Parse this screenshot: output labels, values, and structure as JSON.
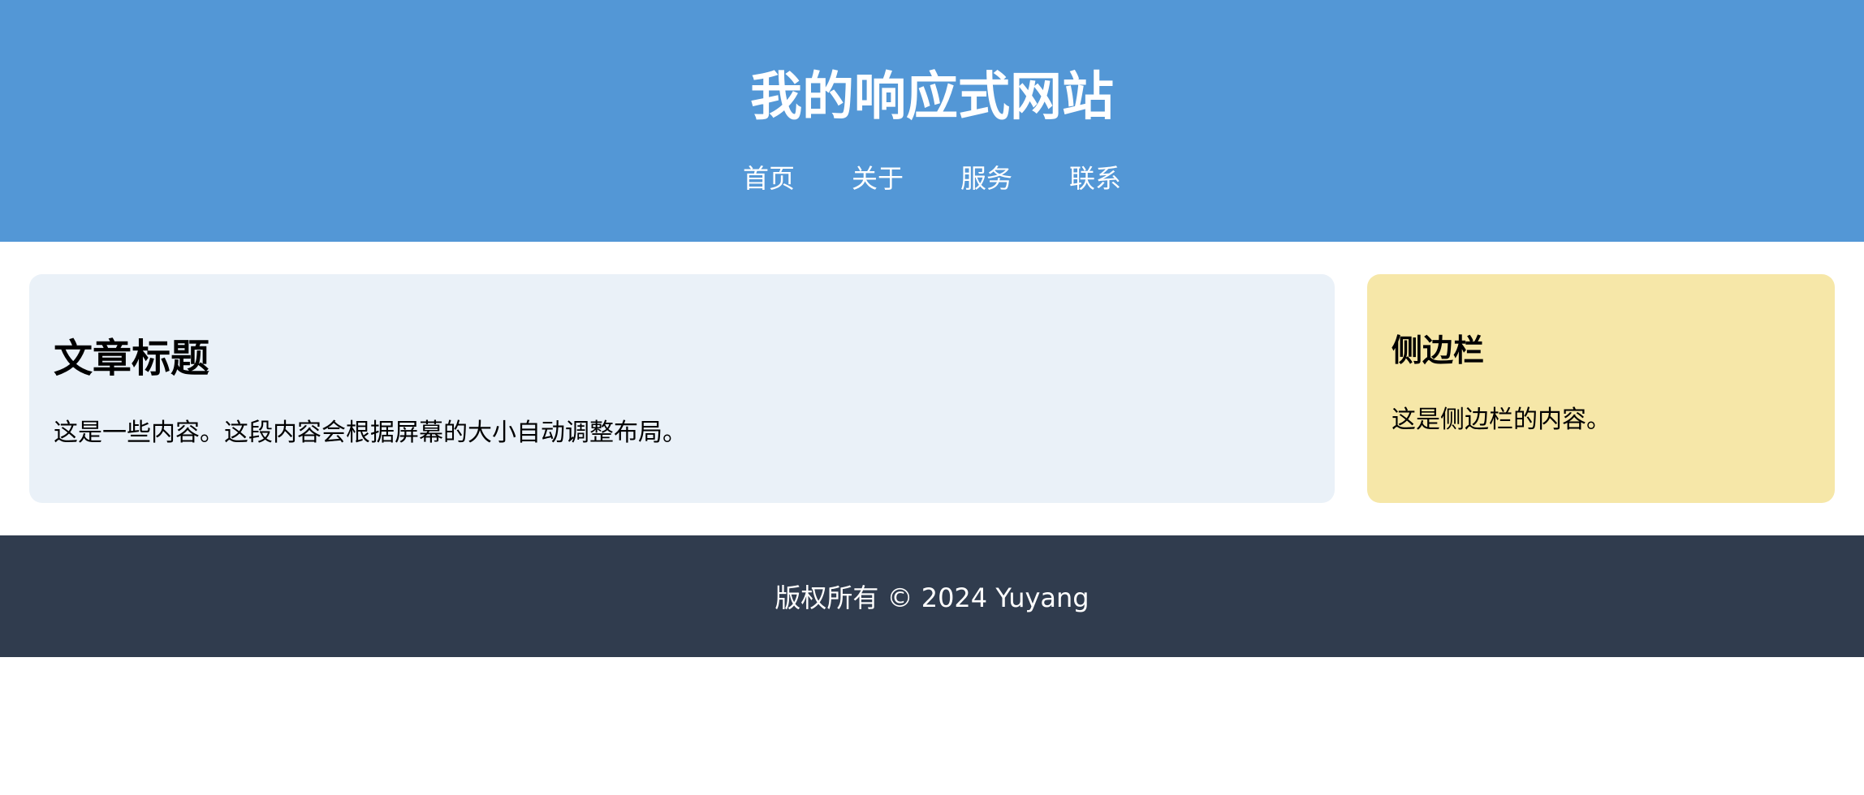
{
  "header": {
    "title": "我的响应式网站",
    "nav": [
      {
        "label": "首页"
      },
      {
        "label": "关于"
      },
      {
        "label": "服务"
      },
      {
        "label": "联系"
      }
    ]
  },
  "article": {
    "title": "文章标题",
    "text": "这是一些内容。这段内容会根据屏幕的大小自动调整布局。"
  },
  "sidebar": {
    "title": "侧边栏",
    "text": "这是侧边栏的内容。"
  },
  "footer": {
    "text": "版权所有 © 2024 Yuyang"
  },
  "colors": {
    "header_bg": "#5397d6",
    "article_bg": "#eaf1f8",
    "sidebar_bg": "#f6e7a8",
    "footer_bg": "#303c4e"
  }
}
